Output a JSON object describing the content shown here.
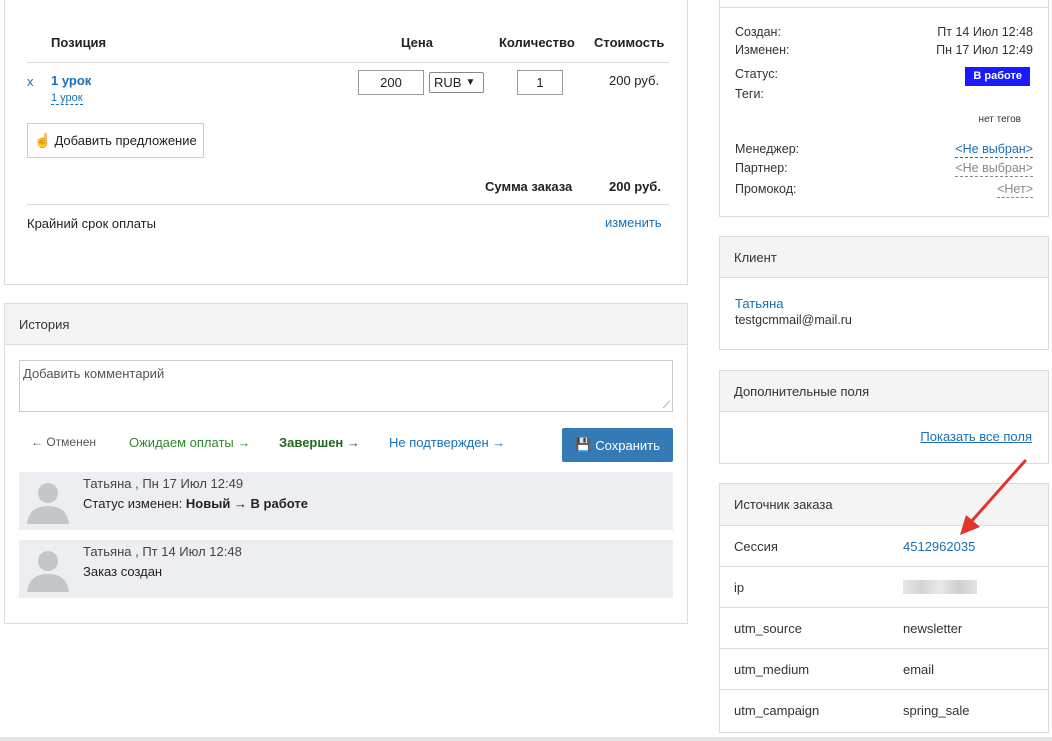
{
  "order": {
    "headers": {
      "position": "Позиция",
      "price": "Цена",
      "quantity": "Количество",
      "cost": "Стоимость"
    },
    "item": {
      "remove": "x",
      "name": "1 урок",
      "sub": "1 урок",
      "price": "200",
      "currency": "RUB",
      "quantity": "1",
      "cost": "200 руб."
    },
    "add_offer": "Добавить предложение",
    "total_label": "Сумма заказа",
    "total_value": "200 руб.",
    "deadline_label": "Крайний срок оплаты",
    "deadline_edit": "изменить"
  },
  "history": {
    "title": "История",
    "comment_placeholder": "Добавить комментарий",
    "statuses": {
      "cancelled": "← Отменен",
      "awaiting": "Ожидаем оплаты →",
      "completed": "Завершен →",
      "unconfirmed": "Не подтвержден →"
    },
    "save": "Сохранить",
    "items": [
      {
        "meta": "Татьяна , Пн 17 Июл 12:49",
        "prefix": "Статус изменен: ",
        "text": "Новый → В работе"
      },
      {
        "meta": "Татьяна , Пт 14 Июл 12:48",
        "prefix": "",
        "text": "Заказ создан"
      }
    ]
  },
  "info": {
    "created_label": "Создан:",
    "created_value": "Пт 14 Июл 12:48",
    "modified_label": "Изменен:",
    "modified_value": "Пн 17 Июл 12:49",
    "status_label": "Статус:",
    "status_value": "В работе",
    "tags_label": "Теги:",
    "tags_value": "нет тегов",
    "manager_label": "Менеджер:",
    "manager_value": "<Не выбран>",
    "partner_label": "Партнер:",
    "partner_value": "<Не выбран>",
    "promo_label": "Промокод:",
    "promo_value": "<Нет>"
  },
  "client": {
    "title": "Клиент",
    "name": "Татьяна",
    "email": "testgcmmail@mail.ru"
  },
  "extra": {
    "title": "Дополнительные поля",
    "show_all": "Показать все поля"
  },
  "source": {
    "title": "Источник заказа",
    "rows": [
      {
        "key": "Сессия",
        "value": "4512962035"
      },
      {
        "key": "ip",
        "value": ""
      },
      {
        "key": "utm_source",
        "value": "newsletter"
      },
      {
        "key": "utm_medium",
        "value": "email"
      },
      {
        "key": "utm_campaign",
        "value": "spring_sale"
      }
    ]
  },
  "colors": {
    "link": "#1a6fb5",
    "green": "#2f8a2f",
    "dark_green": "#1e6b1e",
    "save_bg": "#337ab7",
    "badge": "#1a1aff",
    "arrow": "#e0352b"
  }
}
